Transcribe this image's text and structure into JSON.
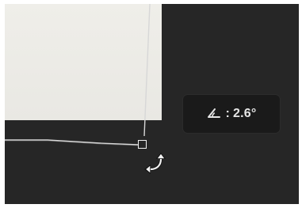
{
  "rotation_tooltip": {
    "icon": "angle-icon",
    "label": ":",
    "value": "2.6°"
  },
  "cursor": {
    "icon": "rotate-cursor-icon"
  }
}
